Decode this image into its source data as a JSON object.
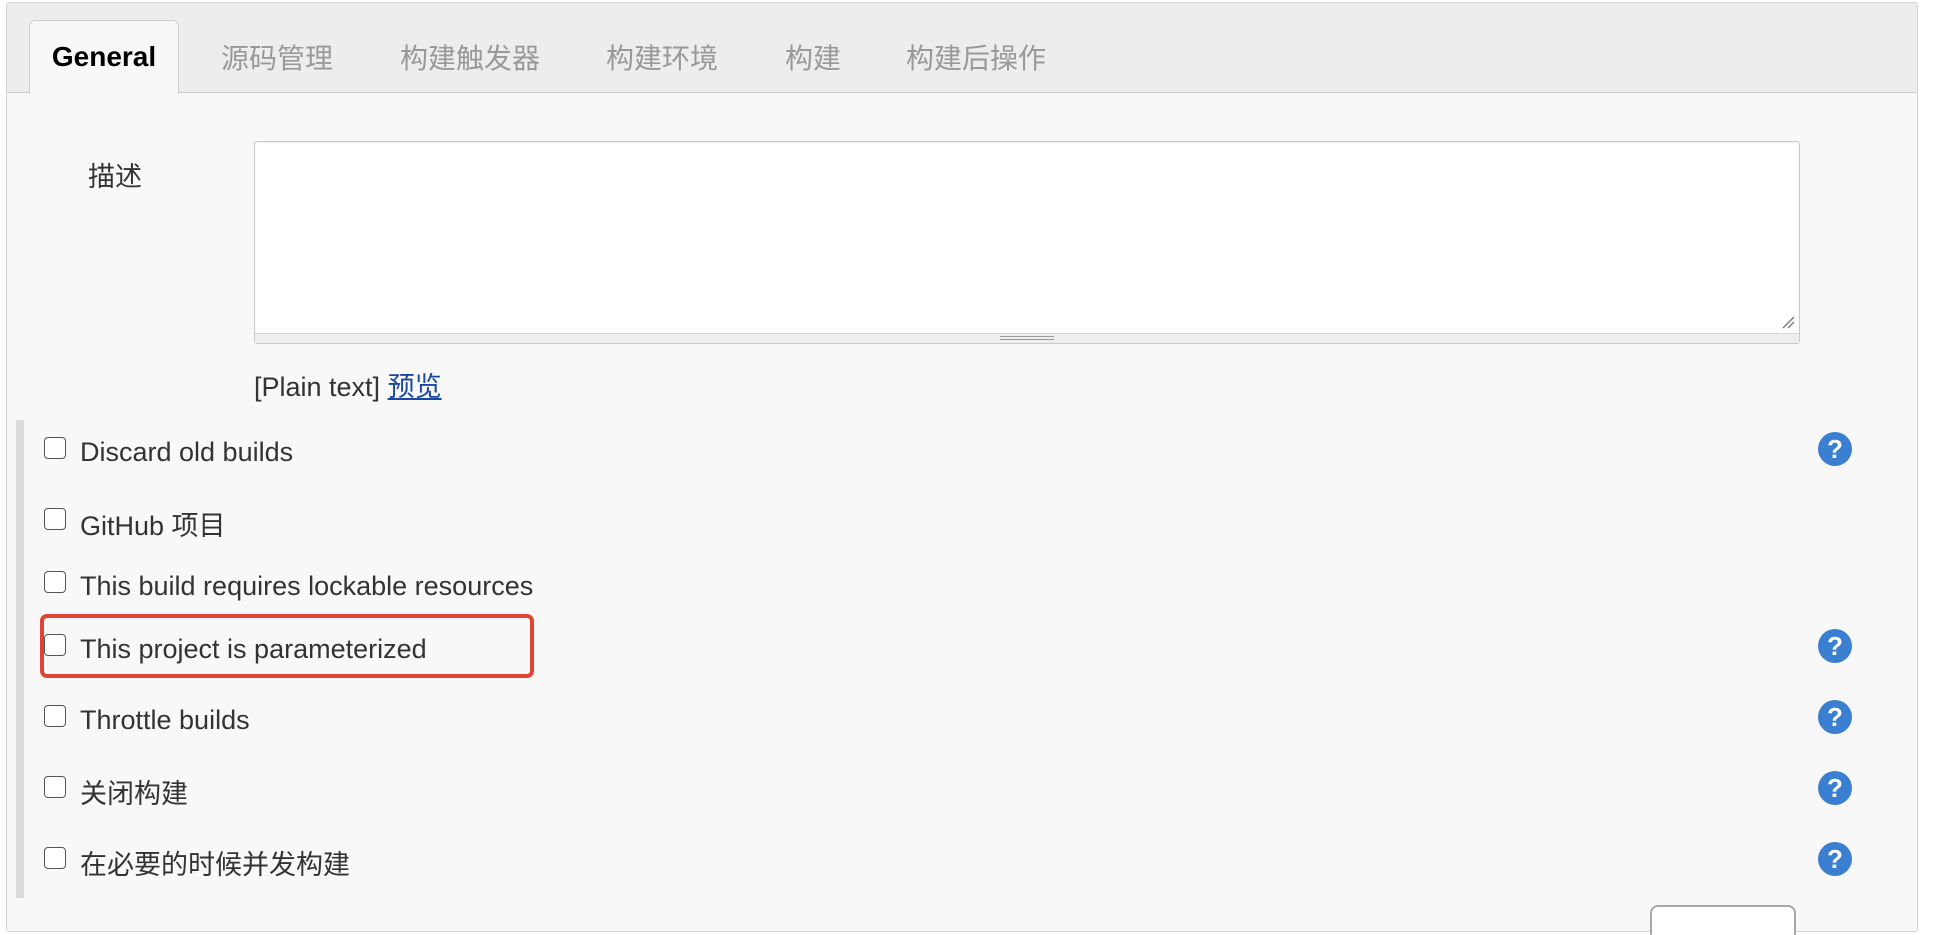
{
  "tabs": [
    {
      "label": "General",
      "active": true
    },
    {
      "label": "源码管理"
    },
    {
      "label": "构建触发器"
    },
    {
      "label": "构建环境"
    },
    {
      "label": "构建"
    },
    {
      "label": "构建后操作"
    }
  ],
  "description": {
    "label": "描述",
    "value": "",
    "format_text": "[Plain text]",
    "preview_link": "预览"
  },
  "options": [
    {
      "label": "Discard old builds",
      "checked": false,
      "help": true
    },
    {
      "label": "GitHub 项目",
      "checked": false,
      "help": false
    },
    {
      "label": "This build requires lockable resources",
      "checked": false,
      "help": false
    },
    {
      "label": "This project is parameterized",
      "checked": false,
      "help": true,
      "highlighted": true
    },
    {
      "label": "Throttle builds",
      "checked": false,
      "help": true
    },
    {
      "label": "关闭构建",
      "checked": false,
      "help": true
    },
    {
      "label": "在必要的时候并发构建",
      "checked": false,
      "help": true
    }
  ],
  "help_glyph": "?",
  "colors": {
    "help_icon": "#3a7fd0",
    "highlight": "#e04433",
    "link": "#1a49a3"
  }
}
